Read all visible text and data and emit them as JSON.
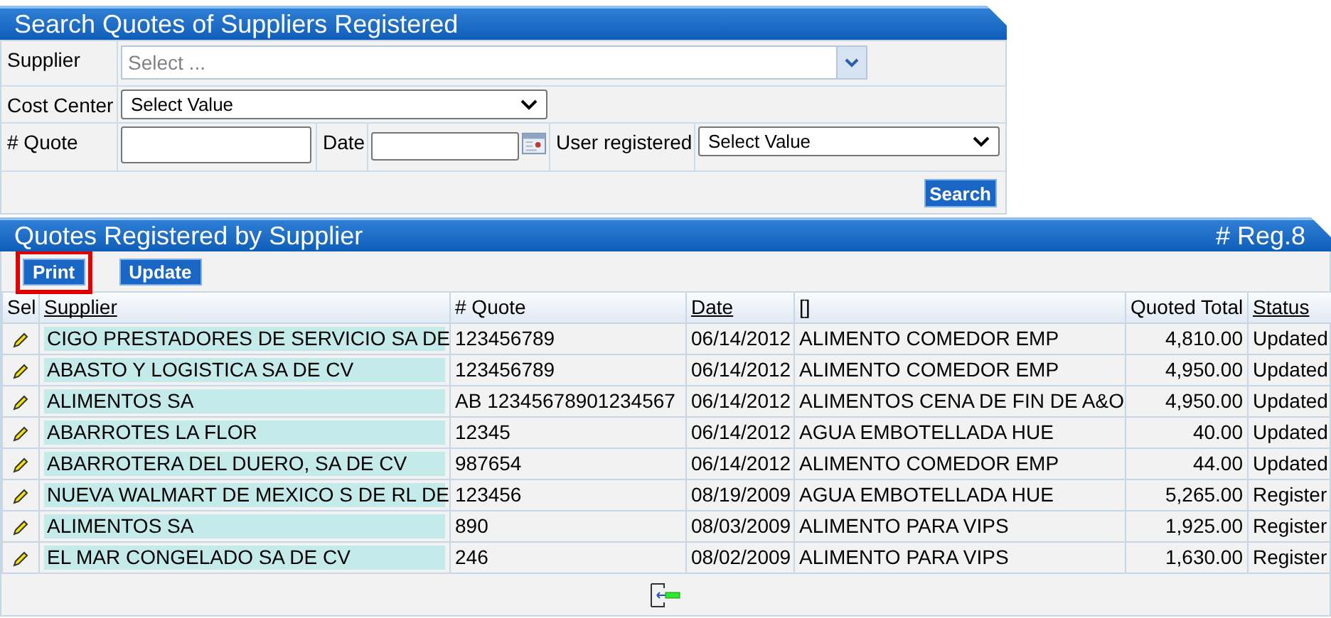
{
  "search_panel": {
    "title": "Search Quotes of Suppliers Registered",
    "supplier": {
      "label": "Supplier",
      "placeholder": "Select ..."
    },
    "cost_center": {
      "label": "Cost Center",
      "value": "Select Value"
    },
    "quote": {
      "label": "# Quote"
    },
    "date": {
      "label": "Date"
    },
    "user_registered": {
      "label": "User registered",
      "value": "Select Value"
    },
    "search_button": "Search"
  },
  "results_panel": {
    "title": "Quotes Registered by Supplier",
    "count": "# Reg.8",
    "buttons": [
      {
        "label": "Print",
        "highlighted": true
      },
      {
        "label": "Update",
        "highlighted": false
      }
    ],
    "columns": [
      {
        "label": "Sel",
        "link": false
      },
      {
        "label": "Supplier",
        "link": true
      },
      {
        "label": "# Quote",
        "link": false
      },
      {
        "label": "Date",
        "link": true
      },
      {
        "label": "[]",
        "link": false
      },
      {
        "label": "Quoted Total",
        "link": false
      },
      {
        "label": "Status",
        "link": true
      }
    ],
    "rows": [
      {
        "supplier": "CIGO PRESTADORES DE SERVICIO SA DE",
        "quote": "123456789",
        "date": "06/14/2012",
        "description": "ALIMENTO COMEDOR EMP",
        "total": "4,810.00",
        "status": "Updated"
      },
      {
        "supplier": "ABASTO Y LOGISTICA SA DE CV",
        "quote": "123456789",
        "date": "06/14/2012",
        "description": "ALIMENTO COMEDOR EMP",
        "total": "4,950.00",
        "status": "Updated"
      },
      {
        "supplier": "ALIMENTOS SA",
        "quote": "AB 12345678901234567",
        "date": "06/14/2012",
        "description": "ALIMENTOS CENA DE FIN DE A&O",
        "total": "4,950.00",
        "status": "Updated"
      },
      {
        "supplier": "ABARROTES LA FLOR",
        "quote": "12345",
        "date": "06/14/2012",
        "description": "AGUA EMBOTELLADA HUE",
        "total": "40.00",
        "status": "Updated"
      },
      {
        "supplier": "ABARROTERA DEL DUERO, SA DE CV",
        "quote": "987654",
        "date": "06/14/2012",
        "description": "ALIMENTO COMEDOR EMP",
        "total": "44.00",
        "status": "Updated"
      },
      {
        "supplier": "NUEVA WALMART DE MEXICO S DE RL DE",
        "quote": "123456",
        "date": "08/19/2009",
        "description": "AGUA EMBOTELLADA HUE",
        "total": "5,265.00",
        "status": "Register"
      },
      {
        "supplier": "ALIMENTOS SA",
        "quote": "890",
        "date": "08/03/2009",
        "description": "ALIMENTO PARA VIPS",
        "total": "1,925.00",
        "status": "Register"
      },
      {
        "supplier": "EL MAR CONGELADO SA DE CV",
        "quote": "246",
        "date": "08/02/2009",
        "description": "ALIMENTO PARA VIPS",
        "total": "1,630.00",
        "status": "Register"
      }
    ]
  }
}
